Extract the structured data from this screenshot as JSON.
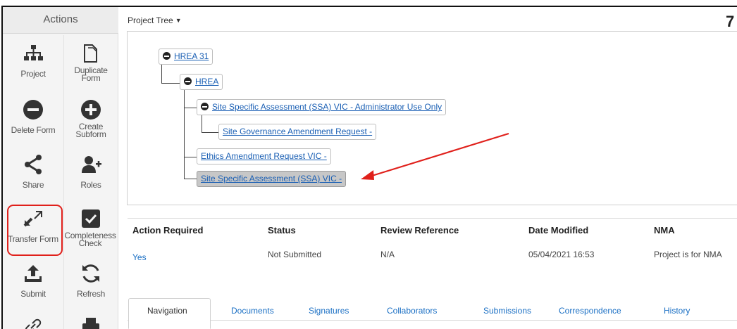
{
  "actions": {
    "title": "Actions",
    "items": [
      {
        "label": "Project",
        "icon": "sitemap-icon"
      },
      {
        "label": "Duplicate Form",
        "icon": "duplicate-icon"
      },
      {
        "label": "Delete Form",
        "icon": "minus-circle-icon"
      },
      {
        "label": "Create Subform",
        "icon": "plus-circle-icon"
      },
      {
        "label": "Share",
        "icon": "share-icon"
      },
      {
        "label": "Roles",
        "icon": "add-user-icon"
      },
      {
        "label": "Transfer Form",
        "icon": "transfer-icon"
      },
      {
        "label": "Completeness Check",
        "icon": "checkbox-icon"
      },
      {
        "label": "Submit",
        "icon": "upload-icon"
      },
      {
        "label": "Refresh",
        "icon": "refresh-icon"
      },
      {
        "label": "",
        "icon": "link-icon"
      },
      {
        "label": "",
        "icon": "print-icon"
      }
    ],
    "highlight_color": "#e0201b"
  },
  "tree": {
    "title": "Project Tree",
    "corner_number": "7",
    "nodes": [
      {
        "label": "HREA 31",
        "collapsible": true
      },
      {
        "label": "HREA",
        "collapsible": true
      },
      {
        "label": "Site Specific Assessment (SSA) VIC - Administrator Use Only",
        "collapsible": true
      },
      {
        "label": "Site Governance Amendment Request -",
        "collapsible": false
      },
      {
        "label": "Ethics Amendment Request VIC -",
        "collapsible": false
      },
      {
        "label": "Site Specific Assessment (SSA) VIC -",
        "collapsible": false,
        "selected": true
      }
    ]
  },
  "info": {
    "headers": [
      "Action Required",
      "Status",
      "Review Reference",
      "Date Modified",
      "NMA"
    ],
    "values": [
      "Yes",
      "Not Submitted",
      "N/A",
      "05/04/2021 16:53",
      "Project is for NMA"
    ]
  },
  "tabs": [
    "Navigation",
    "Documents",
    "Signatures",
    "Collaborators",
    "Submissions",
    "Correspondence",
    "History"
  ],
  "colors": {
    "link": "#1a6fc4",
    "annotation": "#e0201b",
    "selected_node": "#c7c7c7"
  }
}
